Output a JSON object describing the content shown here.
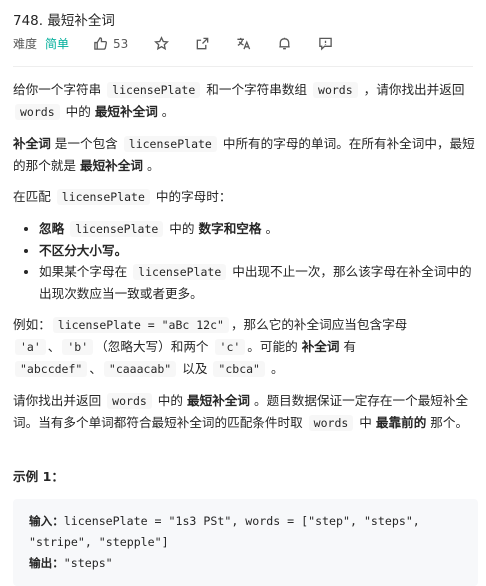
{
  "problem": {
    "title": "748. 最短补全词",
    "difficulty_label": "难度",
    "difficulty": "简单",
    "likes": "53"
  },
  "desc": {
    "p1": {
      "a": "给你一个字符串 ",
      "code1": "licensePlate",
      "b": " 和一个字符串数组 ",
      "code2": "words",
      "c": " ，请你找出并返回 ",
      "code3": "words",
      "d": " 中的 ",
      "bold": "最短补全词",
      "e": " 。"
    },
    "p2": {
      "bold1": "补全词",
      "a": " 是一个包含 ",
      "code1": "licensePlate",
      "b": " 中所有的字母的单词。在所有补全词中，最短的那个就是 ",
      "bold2": "最短补全词",
      "c": " 。"
    },
    "p3": {
      "a": "在匹配 ",
      "code1": "licensePlate",
      "b": " 中的字母时："
    },
    "bullets": {
      "b1": {
        "bold1": "忽略",
        "code1": "licensePlate",
        "a": " 中的 ",
        "bold2": "数字和空格",
        "b": " 。"
      },
      "b2": {
        "bold1": "不区分大小写。"
      },
      "b3": {
        "a": "如果某个字母在 ",
        "code1": "licensePlate",
        "b": " 中出现不止一次，那么该字母在补全词中的出现次数应当一致或者更多。"
      }
    },
    "p4": {
      "a": "例如：",
      "code1": "licensePlate = \"aBc 12c\"",
      "b": "，那么它的补全词应当包含字母 ",
      "code2": "'a'",
      "c": "、",
      "code3": "'b'",
      "d": "（忽略大写）和两个 ",
      "code4": "'c'",
      "e": "。可能的 ",
      "bold": "补全词",
      "f": " 有 ",
      "code5": "\"abccdef\"",
      "g": "、",
      "code6": "\"caaacab\"",
      "h": " 以及 ",
      "code7": "\"cbca\"",
      "i": " 。"
    },
    "p5": {
      "a": "请你找出并返回 ",
      "code1": "words",
      "b": " 中的 ",
      "bold1": "最短补全词",
      "c": " 。题目数据保证一定存在一个最短补全词。当有多个单词都符合最短补全词的匹配条件时取 ",
      "code2": "words",
      "d": " 中 ",
      "bold2": "最靠前的",
      "e": " 那个。"
    }
  },
  "example": {
    "title": "示例 1：",
    "input_label": "输入：",
    "input_value": "licensePlate = \"1s3 PSt\", words = [\"step\", \"steps\", \"stripe\", \"stepple\"]",
    "output_label": "输出：",
    "output_value": "\"steps\""
  }
}
